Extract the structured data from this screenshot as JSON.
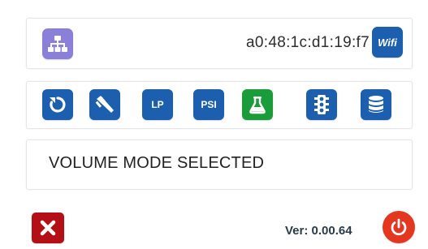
{
  "network": {
    "icon": "network-icon",
    "mac_address": "a0:48:1c:d1:19:f7",
    "wifi_label": "Wifi"
  },
  "toolbar": {
    "items": [
      {
        "icon": "reset-icon"
      },
      {
        "icon": "caliper-icon"
      },
      {
        "label": "LP"
      },
      {
        "label": "PSI"
      },
      {
        "icon": "flask-icon"
      },
      {
        "icon": "traffic-light-icon"
      },
      {
        "icon": "database-icon"
      }
    ]
  },
  "message": "VOLUME MODE SELECTED",
  "footer": {
    "close_icon": "close-icon",
    "version": "Ver: 0.00.64",
    "power_icon": "power-icon"
  },
  "colors": {
    "primary_blue": "#1c5fae",
    "green": "#1a9c3a",
    "purple": "#8a80d9",
    "close_red": "#b40f16",
    "power_red": "#e5361f"
  }
}
